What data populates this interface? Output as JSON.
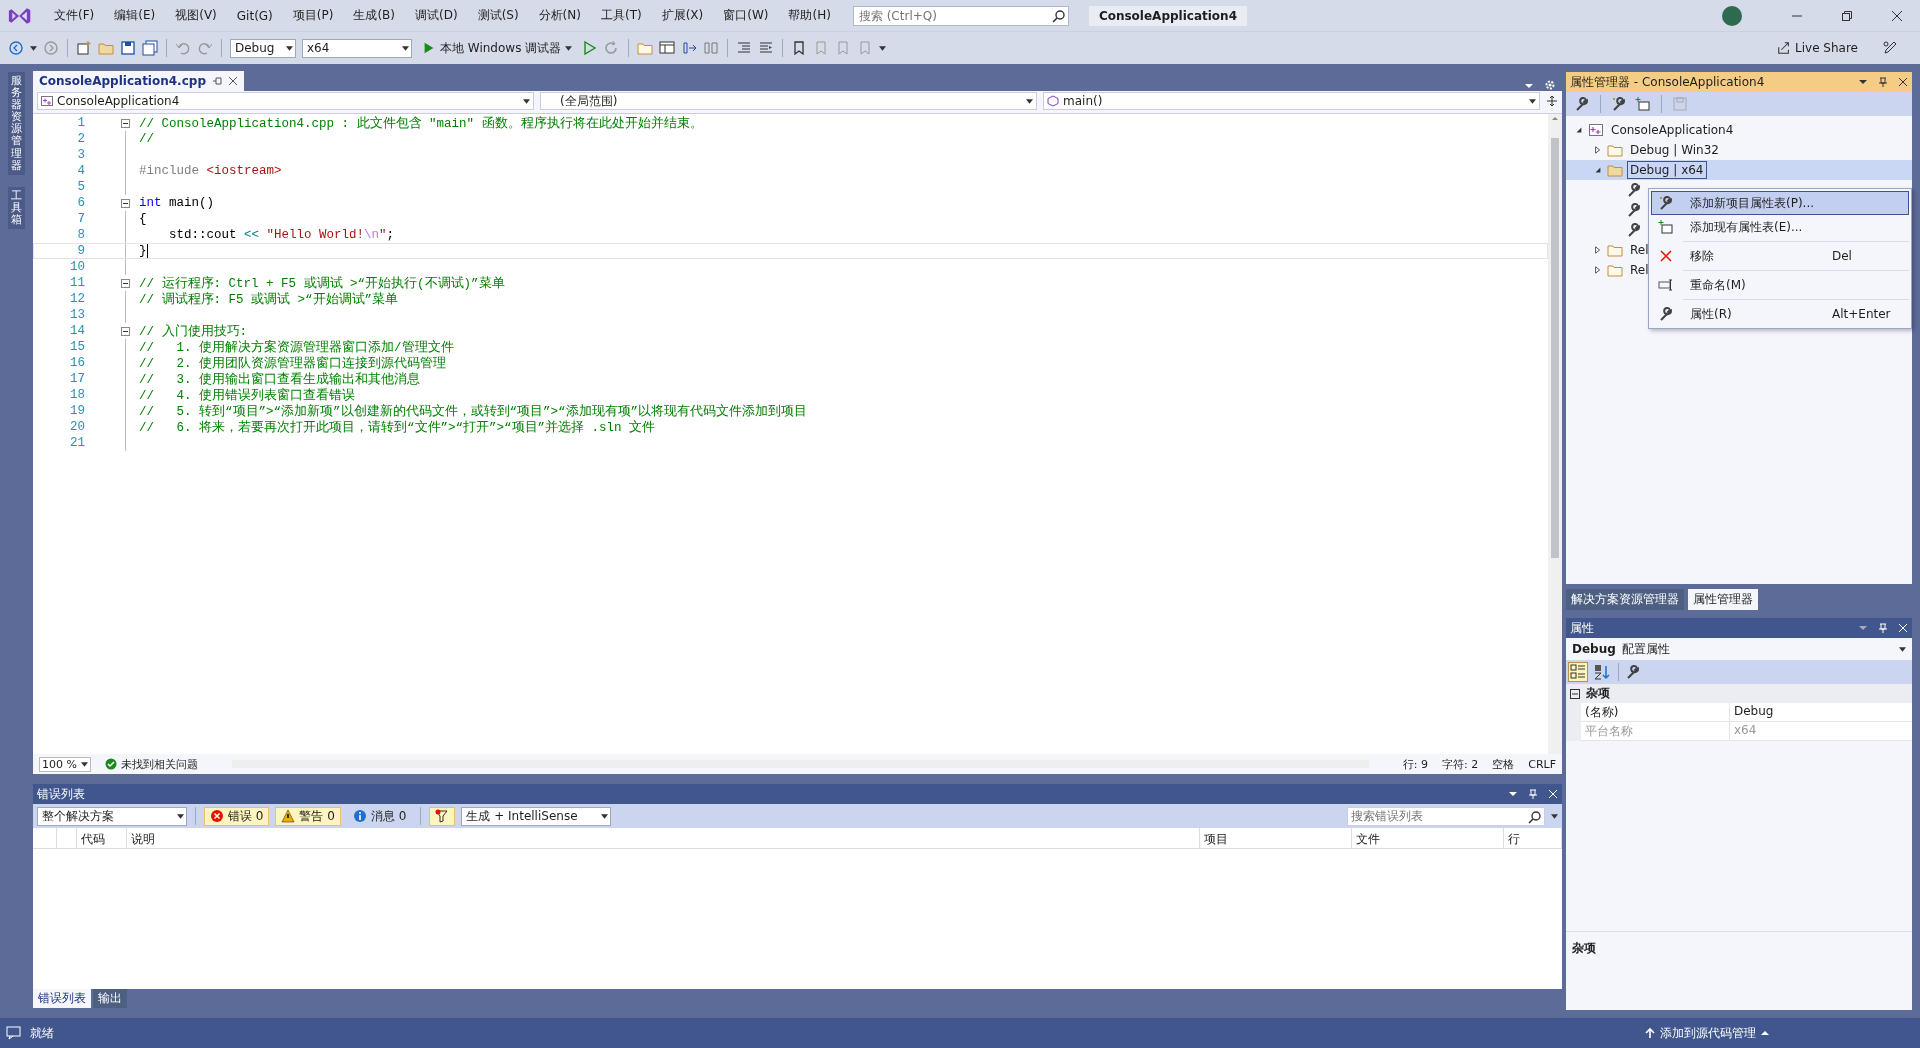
{
  "menu_bar": {
    "items": [
      "文件(F)",
      "编辑(E)",
      "视图(V)",
      "Git(G)",
      "项目(P)",
      "生成(B)",
      "调试(D)",
      "测试(S)",
      "分析(N)",
      "工具(T)",
      "扩展(X)",
      "窗口(W)",
      "帮助(H)"
    ],
    "search": {
      "placeholder": "搜索 (Ctrl+Q)"
    },
    "solution_title": "ConsoleApplication4"
  },
  "toolbar": {
    "configuration": "Debug",
    "platform": "x64",
    "debugger": "本地 Windows 调试器",
    "live_share": "Live Share"
  },
  "side_tabs": [
    "服务器资源管理器",
    "工具箱"
  ],
  "editor": {
    "tabs": [
      {
        "label": "ConsoleApplication4.cpp",
        "selected": true
      }
    ],
    "navigation": [
      "ConsoleApplication4",
      "(全局范围)",
      "main()"
    ],
    "lines": [
      {
        "number": "1",
        "fold_start": true,
        "current": false,
        "tokens": [
          {
            "kind": "comment",
            "text": "// ConsoleApplication4.cpp : 此文件包含 \"main\" 函数。程序执行将在此处开始并结束。"
          }
        ]
      },
      {
        "number": "2",
        "fold_start": false,
        "current": false,
        "tokens": [
          {
            "kind": "comment",
            "text": "//"
          }
        ]
      },
      {
        "number": "3",
        "fold_start": false,
        "current": false
      },
      {
        "number": "4",
        "fold_start": false,
        "current": false,
        "tokens": [
          {
            "kind": "preproc",
            "text": "#include "
          },
          {
            "kind": "string",
            "text": "<iostream>"
          }
        ]
      },
      {
        "number": "5",
        "fold_start": false,
        "current": false
      },
      {
        "number": "6",
        "fold_start": true,
        "current": false,
        "tokens": [
          {
            "kind": "keyword",
            "text": "int"
          },
          {
            "kind": "plain",
            "text": " main()"
          }
        ]
      },
      {
        "number": "7",
        "fold_start": false,
        "current": false,
        "tokens": [
          {
            "kind": "plain",
            "text": "{"
          }
        ]
      },
      {
        "number": "8",
        "fold_start": false,
        "current": false,
        "tokens": [
          {
            "kind": "plain",
            "text": "    std::cout "
          },
          {
            "kind": "operator",
            "text": "<<"
          },
          {
            "kind": "string",
            "text": " \"Hello World!"
          },
          {
            "kind": "escape",
            "text": "\\n"
          },
          {
            "kind": "string",
            "text": "\""
          },
          {
            "kind": "plain",
            "text": ";"
          }
        ]
      },
      {
        "number": "9",
        "fold_start": false,
        "current": true,
        "tokens": [
          {
            "kind": "plain",
            "text": "}"
          }
        ]
      },
      {
        "number": "10",
        "fold_start": false,
        "current": false
      },
      {
        "number": "11",
        "fold_start": true,
        "current": false,
        "tokens": [
          {
            "kind": "comment",
            "text": "// 运行程序: Ctrl + F5 或调试 >“开始执行(不调试)”菜单"
          }
        ]
      },
      {
        "number": "12",
        "fold_start": false,
        "current": false,
        "tokens": [
          {
            "kind": "comment",
            "text": "// 调试程序: F5 或调试 >“开始调试”菜单"
          }
        ]
      },
      {
        "number": "13",
        "fold_start": false,
        "current": false
      },
      {
        "number": "14",
        "fold_start": true,
        "current": false,
        "tokens": [
          {
            "kind": "comment",
            "text": "// 入门使用技巧: "
          }
        ]
      },
      {
        "number": "15",
        "fold_start": false,
        "current": false,
        "tokens": [
          {
            "kind": "comment",
            "text": "//   1. 使用解决方案资源管理器窗口添加/管理文件"
          }
        ]
      },
      {
        "number": "16",
        "fold_start": false,
        "current": false,
        "tokens": [
          {
            "kind": "comment",
            "text": "//   2. 使用团队资源管理器窗口连接到源代码管理"
          }
        ]
      },
      {
        "number": "17",
        "fold_start": false,
        "current": false,
        "tokens": [
          {
            "kind": "comment",
            "text": "//   3. 使用输出窗口查看生成输出和其他消息"
          }
        ]
      },
      {
        "number": "18",
        "fold_start": false,
        "current": false,
        "tokens": [
          {
            "kind": "comment",
            "text": "//   4. 使用错误列表窗口查看错误"
          }
        ]
      },
      {
        "number": "19",
        "fold_start": false,
        "current": false,
        "tokens": [
          {
            "kind": "comment",
            "text": "//   5. 转到“项目”>“添加新项”以创建新的代码文件，或转到“项目”>“添加现有项”以将现有代码文件添加到项目"
          }
        ]
      },
      {
        "number": "20",
        "fold_start": false,
        "current": false,
        "tokens": [
          {
            "kind": "comment",
            "text": "//   6. 将来，若要再次打开此项目，请转到“文件”>“打开”>“项目”并选择 .sln 文件"
          }
        ]
      },
      {
        "number": "21",
        "fold_start": false,
        "current": false
      }
    ],
    "status": {
      "zoom": "100 %",
      "issues": "未找到相关问题",
      "line": "行: 9",
      "char": "字符: 2",
      "indent": "空格",
      "eol": "CRLF"
    }
  },
  "error_list": {
    "title": "错误列表",
    "scope": "整个解决方案",
    "toggles": [
      {
        "kind": "error",
        "label": "错误 0",
        "selected": true
      },
      {
        "kind": "warning",
        "label": "警告 0",
        "selected": true
      },
      {
        "kind": "info",
        "label": "消息 0",
        "selected": false
      }
    ],
    "source": "生成 + IntelliSense",
    "search": {
      "placeholder": "搜索错误列表"
    },
    "columns": [
      "代码",
      "说明",
      "项目",
      "文件",
      "行"
    ]
  },
  "bottom_tabs": [
    {
      "label": "错误列表",
      "selected": true
    },
    {
      "label": "输出",
      "selected": false
    }
  ],
  "property_manager": {
    "title": "属性管理器 - ConsoleApplication4",
    "tree": [
      {
        "kind": "project",
        "label": "ConsoleApplication4",
        "expanded": true,
        "selected": false,
        "children": [
          {
            "kind": "config",
            "label": "Debug | Win32",
            "expanded": false,
            "selected": false
          },
          {
            "kind": "config",
            "label": "Debug | x64",
            "expanded": true,
            "selected": true,
            "children": [
              {
                "kind": "sheet",
                "selected": false
              },
              {
                "kind": "sheet",
                "selected": false
              },
              {
                "kind": "sheet",
                "selected": false
              }
            ]
          },
          {
            "kind": "config",
            "label": "Rel",
            "expanded": false,
            "selected": false
          },
          {
            "kind": "config",
            "label": "Rel",
            "expanded": false,
            "selected": false
          }
        ]
      }
    ]
  },
  "context_menu": [
    {
      "kind": "new-sheet",
      "label": "添加新项目属性表(P)...",
      "selected": true
    },
    {
      "kind": "existing-sheet",
      "label": "添加现有属性表(E)...",
      "selected": false
    },
    {
      "kind": "remove",
      "label": "移除",
      "shortcut": "Del",
      "selected": false
    },
    {
      "kind": "rename",
      "label": "重命名(M)",
      "selected": false
    },
    {
      "kind": "properties",
      "label": "属性(R)",
      "shortcut": "Alt+Enter",
      "selected": false
    }
  ],
  "right_tabs": [
    {
      "label": "解决方案资源管理器",
      "selected": false
    },
    {
      "label": "属性管理器",
      "selected": true
    }
  ],
  "properties": {
    "title": "属性",
    "object_name": "Debug",
    "object_type": "配置属性",
    "view_modes": [
      {
        "kind": "categorized",
        "selected": true
      },
      {
        "kind": "alphabetical",
        "selected": false
      }
    ],
    "category": {
      "label": "杂项",
      "expanded": true
    },
    "rows": [
      {
        "name": "(名称)",
        "value": "Debug",
        "disabled": false
      },
      {
        "name": "平台名称",
        "value": "x64",
        "disabled": true
      }
    ],
    "description": "杂项"
  },
  "status_bar": {
    "state": "就绪",
    "source_control": "添加到源代码管理"
  }
}
